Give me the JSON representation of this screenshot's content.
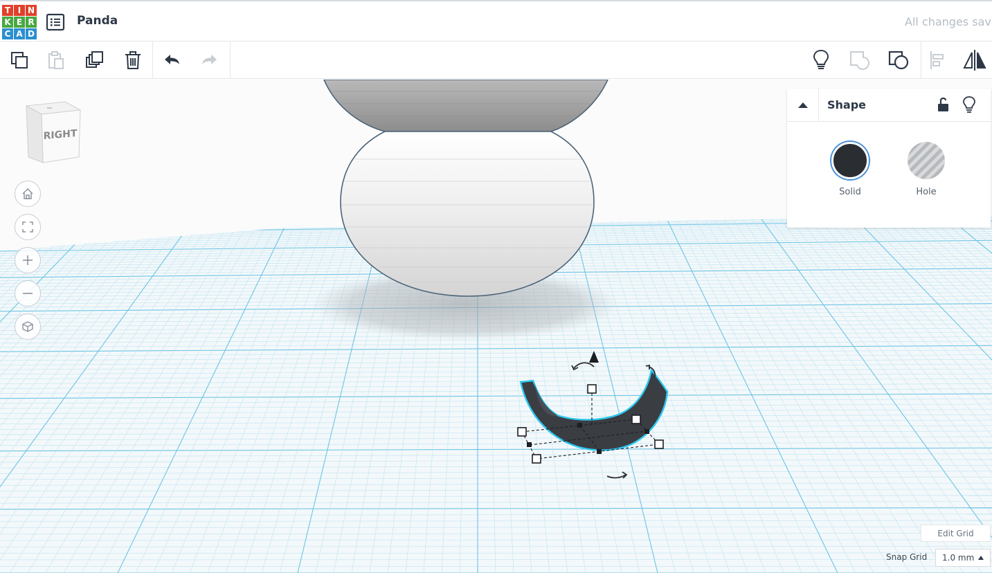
{
  "logo": {
    "letters": [
      "T",
      "I",
      "N",
      "K",
      "E",
      "R",
      "C",
      "A",
      "D"
    ],
    "colors": [
      "#e2402a",
      "#e2402a",
      "#e2402a",
      "#48a842",
      "#48a842",
      "#48a842",
      "#2b8fd0",
      "#2b8fd0",
      "#2b8fd0"
    ]
  },
  "header": {
    "menu_icon": "list-icon",
    "project_title": "Panda",
    "save_status": "All changes saved"
  },
  "toolbar": {
    "left": [
      {
        "name": "copy-button",
        "icon": "copy-icon",
        "enabled": true
      },
      {
        "name": "paste-button",
        "icon": "paste-icon",
        "enabled": false
      },
      {
        "name": "duplicate-button",
        "icon": "duplicate-icon",
        "enabled": true
      },
      {
        "name": "delete-button",
        "icon": "trash-icon",
        "enabled": true
      },
      {
        "name": "undo-button",
        "icon": "undo-icon",
        "enabled": true
      },
      {
        "name": "redo-button",
        "icon": "redo-icon",
        "enabled": false
      }
    ],
    "right": [
      {
        "name": "notes-button",
        "icon": "lightbulb-icon",
        "enabled": true
      },
      {
        "name": "group-button",
        "icon": "group-icon",
        "enabled": false
      },
      {
        "name": "ungroup-button",
        "icon": "ungroup-icon",
        "enabled": true
      },
      {
        "name": "align-button",
        "icon": "align-icon",
        "enabled": false
      },
      {
        "name": "mirror-button",
        "icon": "mirror-icon",
        "enabled": true
      }
    ]
  },
  "view": {
    "cube_face": "RIGHT",
    "controls": [
      "home-view-icon",
      "fit-view-icon",
      "zoom-in-icon",
      "zoom-out-icon",
      "projection-icon"
    ]
  },
  "inspector": {
    "title": "Shape",
    "options": [
      {
        "label": "Solid",
        "selected": true,
        "color": "#2a2e33"
      },
      {
        "label": "Hole",
        "selected": false,
        "color": "#b7babd"
      }
    ]
  },
  "grid": {
    "edit_label": "Edit Grid",
    "snap_label": "Snap Grid",
    "snap_value": "1.0 mm"
  },
  "colors": {
    "accent": "#2ec7ef",
    "grid_major": "#6cc4e4",
    "grid_minor": "#bfe4f2",
    "shape": "#3a3d42"
  }
}
